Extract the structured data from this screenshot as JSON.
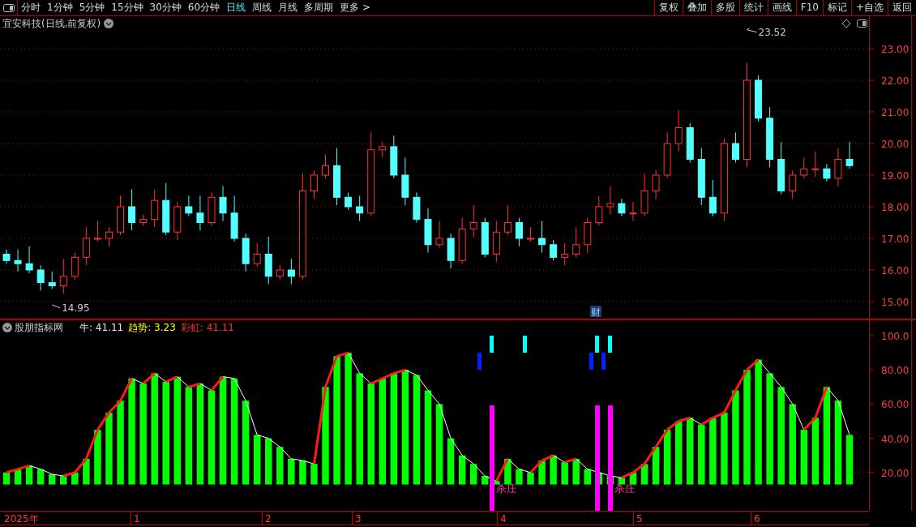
{
  "toolbar": {
    "periods": [
      {
        "label": "分时",
        "selected": false
      },
      {
        "label": "1分钟",
        "selected": false
      },
      {
        "label": "5分钟",
        "selected": false
      },
      {
        "label": "15分钟",
        "selected": false
      },
      {
        "label": "30分钟",
        "selected": false
      },
      {
        "label": "60分钟",
        "selected": false
      },
      {
        "label": "日线",
        "selected": true
      },
      {
        "label": "周线",
        "selected": false
      },
      {
        "label": "月线",
        "selected": false
      },
      {
        "label": "多周期",
        "selected": false
      },
      {
        "label": "更多 >",
        "selected": false
      }
    ],
    "actions": [
      "复权",
      "叠加",
      "多股",
      "统计",
      "画线",
      "F10",
      "标记",
      "+自选",
      "返回"
    ]
  },
  "price_chart": {
    "title": "宜安科技(日线,前复权)",
    "high_label": "23.52",
    "low_label": "14.95",
    "badge": "财",
    "axis_labels": [
      "23.00",
      "22.00",
      "21.00",
      "20.00",
      "19.00",
      "18.00",
      "17.00",
      "16.00",
      "15.00"
    ]
  },
  "indicator": {
    "title": "股朋指标网",
    "legend": [
      {
        "label": "牛: 41.11",
        "color": "#e6e6e6"
      },
      {
        "label": "趋势: 3.23",
        "color": "#ffff00"
      },
      {
        "label": "彩虹: 41.11",
        "color": "#ff3232"
      }
    ],
    "signal_labels": [
      "杀庄",
      "杀庄"
    ],
    "axis_labels": [
      "100.0",
      "80.00",
      "60.00",
      "40.00",
      "20.00"
    ]
  },
  "date_axis": [
    "2025年",
    "1",
    "2",
    "3",
    "4",
    "5",
    "6"
  ]
}
